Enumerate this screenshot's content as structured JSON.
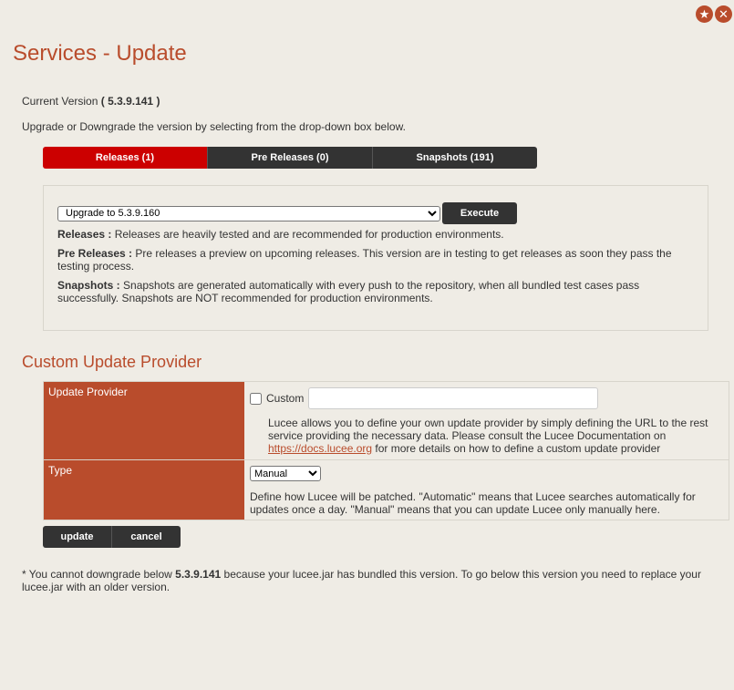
{
  "window": {
    "title": "Services - Update",
    "icons": [
      "star-icon",
      "close-icon"
    ]
  },
  "version": {
    "label": "Current Version",
    "open_paren": "( ",
    "value": "5.3.9.141",
    "close_paren": " )"
  },
  "intro": "Upgrade or Downgrade the version by selecting from the drop-down box below.",
  "tabs": [
    {
      "label": "Releases (1)",
      "active": true
    },
    {
      "label": "Pre Releases (0)",
      "active": false
    },
    {
      "label": "Snapshots (191)",
      "active": false
    }
  ],
  "update": {
    "selected": "Upgrade to 5.3.9.160",
    "execute_label": "Execute"
  },
  "descriptions": {
    "releases_title": "Releases :",
    "releases_text": "Releases are heavily tested and are recommended for production environments.",
    "pre_title": "Pre Releases :",
    "pre_text": "Pre releases a preview on upcoming releases. This version are in testing to get releases as soon they pass the testing process.",
    "snap_title": "Snapshots :",
    "snap_text": "Snapshots are generated automatically with every push to the repository, when all bundled test cases pass successfully. Snapshots are NOT recommended for production environments."
  },
  "custom": {
    "section_title": "Custom Update Provider",
    "provider_label": "Update Provider",
    "checkbox_label": "Custom",
    "url_value": "",
    "provider_desc_1": "Lucee allows you to define your own update provider by simply defining the URL to the rest service providing the necessary data. Please consult the Lucee Documentation on",
    "provider_link": "https://docs.lucee.org",
    "provider_desc_2": "for more details on how to define a custom update provider",
    "type_label": "Type",
    "type_selected": "Manual",
    "type_desc": "Define how Lucee will be patched. \"Automatic\" means that Lucee searches automatically for updates once a day. \"Manual\" means that you can update Lucee only manually here."
  },
  "actions": {
    "update_label": "update",
    "cancel_label": "cancel"
  },
  "footnote": {
    "part1": "* You cannot downgrade below",
    "version": "5.3.9.141",
    "part2": "because your lucee.jar has bundled this version. To go below this version you need to replace your lucee.jar with an older version."
  },
  "colors": {
    "accent": "#b94c2c",
    "active_tab": "#cc0000",
    "dark_button": "#333333",
    "background": "#efece5"
  }
}
